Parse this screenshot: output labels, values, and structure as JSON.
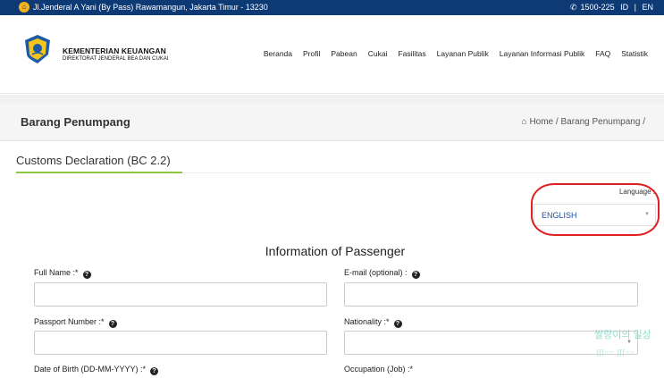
{
  "topbar": {
    "address": "Jl.Jenderal A Yani (By Pass) Rawamangun, Jakarta Timur - 13230",
    "phone": "1500-225",
    "lang_id": "ID",
    "sep": "|",
    "lang_en": "EN"
  },
  "header": {
    "org_line1": "KEMENTERIAN KEUANGAN",
    "org_line2": "DIREKTORAT JENDERAL BEA DAN CUKAI",
    "nav": [
      "Beranda",
      "Profil",
      "Pabean",
      "Cukai",
      "Fasilitas",
      "Layanan Publik",
      "Layanan Informasi Publik",
      "FAQ",
      "Statistik"
    ]
  },
  "page": {
    "title": "Barang Penumpang",
    "breadcrumb_home": "Home",
    "breadcrumb_sep": "/",
    "breadcrumb_current": "Barang Penumpang",
    "breadcrumb_trail": "/"
  },
  "section": {
    "title": "Customs Declaration (BC 2.2)"
  },
  "language": {
    "label": "Language :",
    "selected": "ENGLISH"
  },
  "form": {
    "title": "Information of Passenger",
    "full_name_label": "Full Name :*",
    "email_label": "E-mail (optional) :",
    "passport_label": "Passport Number :*",
    "nationality_label": "Nationality :*",
    "dob_label": "Date of Birth (DD-MM-YYYY) :*",
    "occupation_label": "Occupation (Job) :*",
    "full_name_value": "",
    "email_value": "",
    "passport_value": "",
    "nationality_value": ""
  },
  "watermark": {
    "text": "쌀랑이의 일상",
    "deco": "ʃʃʃ~~ ʃʃʃ~~"
  },
  "colors": {
    "topbar": "#0d3a75",
    "accent_green": "#8dc63f",
    "highlight_red": "#e02020",
    "select_text": "#1f4e9c"
  },
  "icons": {
    "home": "home-icon",
    "phone": "phone-icon",
    "help": "question-circle-icon",
    "logo": "kemenkeu-logo"
  }
}
